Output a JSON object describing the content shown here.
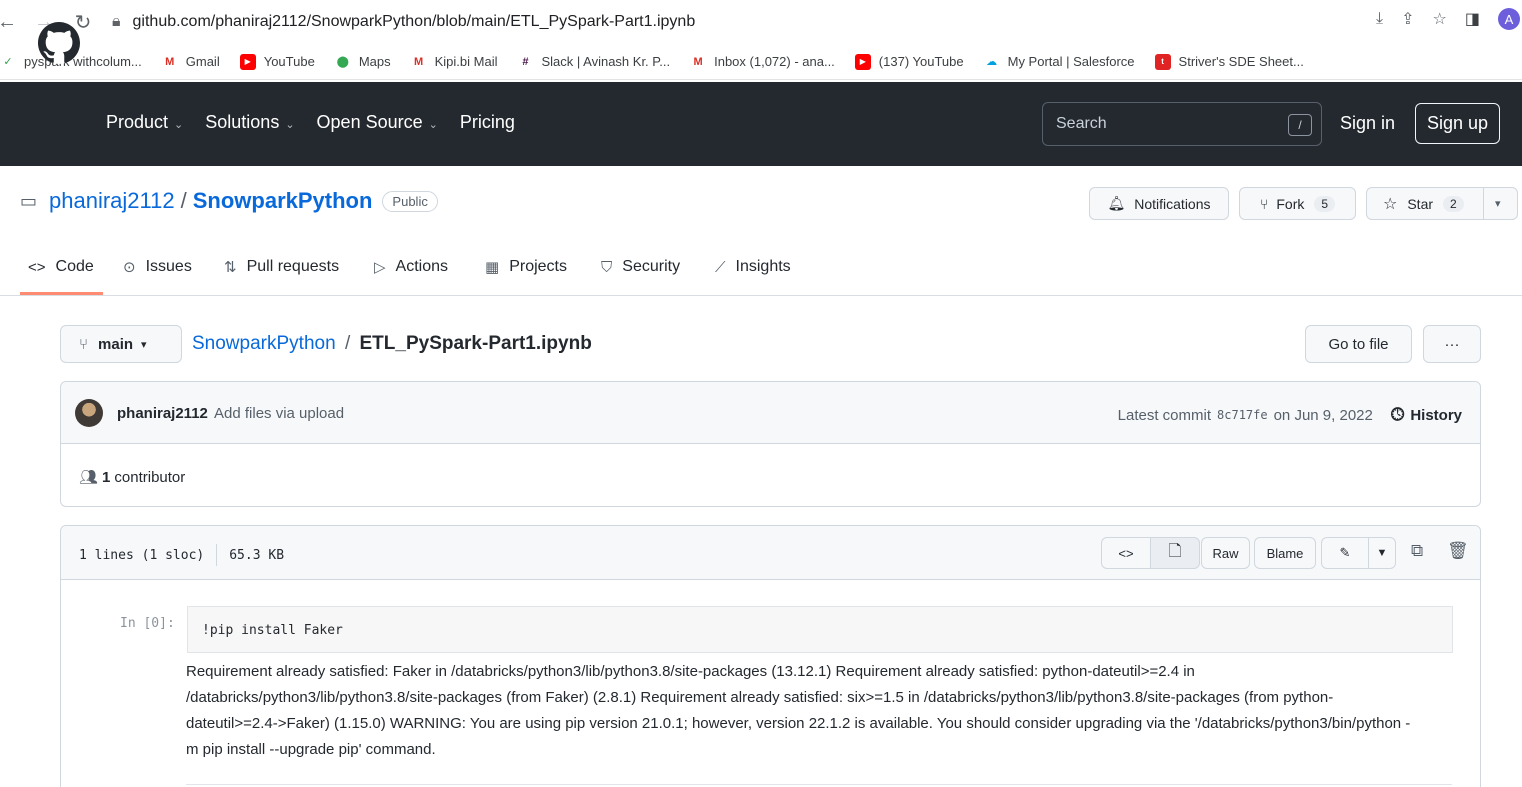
{
  "browser": {
    "url": "github.com/phaniraj2112/SnowparkPython/blob/main/ETL_PySpark-Part1.ipynb",
    "profile_initial": "A",
    "bookmarks": [
      {
        "label": "pyspark withcolum...",
        "icon": "pyspark-icon",
        "color": "#2da44e"
      },
      {
        "label": "Gmail",
        "icon": "gmail-icon",
        "color": "#d93025"
      },
      {
        "label": "YouTube",
        "icon": "youtube-icon",
        "color": "#ff0000"
      },
      {
        "label": "Maps",
        "icon": "maps-icon",
        "color": "#34a853"
      },
      {
        "label": "Kipi.bi Mail",
        "icon": "gmail-icon",
        "color": "#d93025"
      },
      {
        "label": "Slack | Avinash Kr. P...",
        "icon": "slack-icon",
        "color": "#4a154b"
      },
      {
        "label": "Inbox (1,072) - ana...",
        "icon": "gmail-icon",
        "color": "#d93025"
      },
      {
        "label": "(137) YouTube",
        "icon": "youtube-icon",
        "color": "#ff0000"
      },
      {
        "label": "My Portal | Salesforce",
        "icon": "salesforce-icon",
        "color": "#00a1e0"
      },
      {
        "label": "Striver's SDE Sheet...",
        "icon": "tuf-icon",
        "color": "#e02424"
      }
    ]
  },
  "header": {
    "nav": [
      "Product",
      "Solutions",
      "Open Source",
      "Pricing"
    ],
    "search_placeholder": "Search",
    "search_key": "/",
    "sign_in": "Sign in",
    "sign_up": "Sign up"
  },
  "repo": {
    "owner": "phaniraj2112",
    "separator": "/",
    "name": "SnowparkPython",
    "visibility": "Public",
    "notifications": "Notifications",
    "fork_label": "Fork",
    "fork_count": "5",
    "star_label": "Star",
    "star_count": "2"
  },
  "tabs": [
    "Code",
    "Issues",
    "Pull requests",
    "Actions",
    "Projects",
    "Security",
    "Insights"
  ],
  "file": {
    "branch": "main",
    "crumb_repo": "SnowparkPython",
    "crumb_sep": "/",
    "crumb_file": "ETL_PySpark-Part1.ipynb",
    "go_to_file": "Go to file",
    "more": "···"
  },
  "commit": {
    "author": "phaniraj2112",
    "message": "Add files via upload",
    "latest_label": "Latest commit",
    "sha": "8c717fe",
    "date": "on Jun 9, 2022",
    "history": "History",
    "contributors_count": "1",
    "contributors_label": "contributor"
  },
  "file_view": {
    "lines": "1 lines (1 sloc)",
    "size": "65.3 KB",
    "raw": "Raw",
    "blame": "Blame"
  },
  "notebook": {
    "prompt": "In [0]:",
    "code": "!pip install Faker",
    "output": "Requirement already satisfied: Faker in /databricks/python3/lib/python3.8/site-packages (13.12.1) Requirement already satisfied: python-dateutil>=2.4 in /databricks/python3/lib/python3.8/site-packages (from Faker) (2.8.1) Requirement already satisfied: six>=1.5 in /databricks/python3/lib/python3.8/site-packages (from python-dateutil>=2.4->Faker) (1.15.0) WARNING: You are using pip version 21.0.1; however, version 22.1.2 is available. You should consider upgrading via the '/databricks/python3/bin/python -m pip install --upgrade pip' command."
  }
}
